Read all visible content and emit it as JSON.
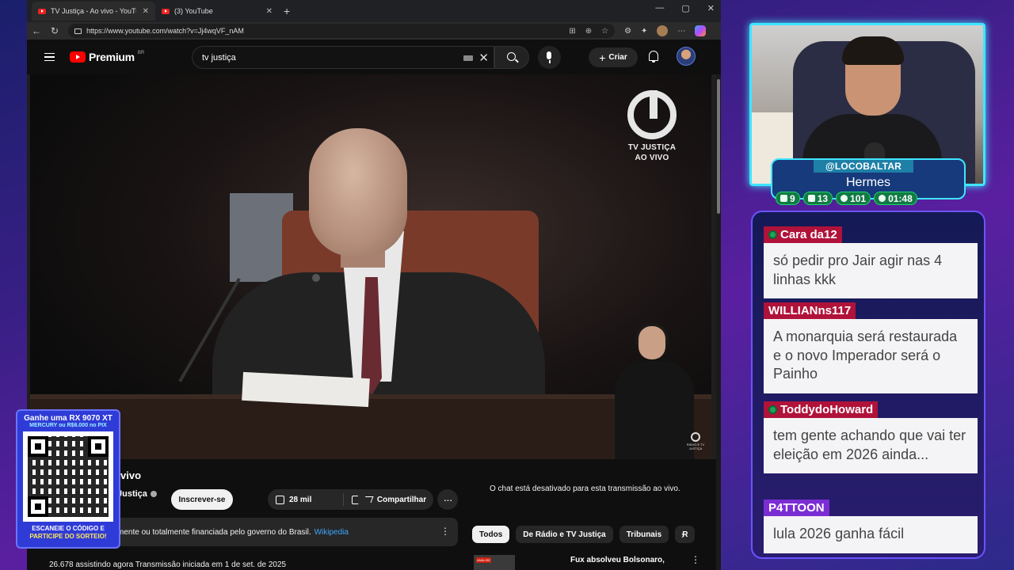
{
  "browser": {
    "tabs": [
      {
        "label": "TV Justiça - Ao vivo - YouTube",
        "active": true
      },
      {
        "label": "(3) YouTube",
        "active": false
      }
    ],
    "url": "https://www.youtube.com/watch?v=Jj4wqVF_nAM"
  },
  "youtube": {
    "logo_text": "Premium",
    "region": "BR",
    "search_query": "tv justiça",
    "create_label": "Criar",
    "video_overlay": {
      "line1": "TV JUSTIÇA",
      "line2": "AO VIVO",
      "corner": "RÁDIO E TV JUSTIÇA"
    },
    "video_title_partial": "vivo",
    "channel_partial": "Justiça",
    "subscribe_label": "Inscrever-se",
    "likes": "28 mil",
    "share_label": "Compartilhar",
    "info_text_partial": "mente ou totalmente financiada pelo governo do Brasil.",
    "info_link": "Wikipedia",
    "viewers_line": "26.678 assistindo agora  Transmissão iniciada em 1 de set. de 2025",
    "chat_disabled": "O chat está desativado para esta transmissão ao vivo.",
    "chips": [
      {
        "label": "Todos",
        "active": true
      },
      {
        "label": "De Rádio e TV Justiça",
        "active": false
      },
      {
        "label": "Tribunais",
        "active": false
      },
      {
        "label": "R",
        "active": false
      }
    ],
    "rec_tag": "ANÁLISE",
    "rec_title": "Fux absolveu Bolsonaro,"
  },
  "promo": {
    "line1": "Ganhe uma RX 9070 XT",
    "line2": "MERCURY ou R$6.000 no PIX",
    "line3": "ESCANEIE O CÓDIGO E",
    "line4": "PARTICIPE DO SORTEIO!"
  },
  "stream": {
    "handle": "@LOCOBALTAR",
    "name": "Hermes",
    "stats": [
      {
        "icon": "chat-icon",
        "value": "9"
      },
      {
        "icon": "youtube-icon",
        "value": "13"
      },
      {
        "icon": "link-icon",
        "value": "101"
      },
      {
        "icon": "clock-icon",
        "value": "01:48"
      }
    ]
  },
  "chat": {
    "messages": [
      {
        "user": "Cara da12",
        "text": "só pedir pro Jair agir nas 4 linhas kkk",
        "badge": true,
        "color": "#b0123a"
      },
      {
        "user": "WILLIANns117",
        "text": "A monarquia será restaurada e o novo Imperador será o Painho",
        "badge": false,
        "color": "#b0123a"
      },
      {
        "user": "ToddydoHoward",
        "text": "tem gente achando que vai ter eleição em 2026 ainda...",
        "badge": true,
        "color": "#b0123a"
      },
      {
        "user": "P4TTOON",
        "text": "lula 2026 ganha fácil",
        "badge": false,
        "color": "#7b2dd4"
      }
    ]
  }
}
